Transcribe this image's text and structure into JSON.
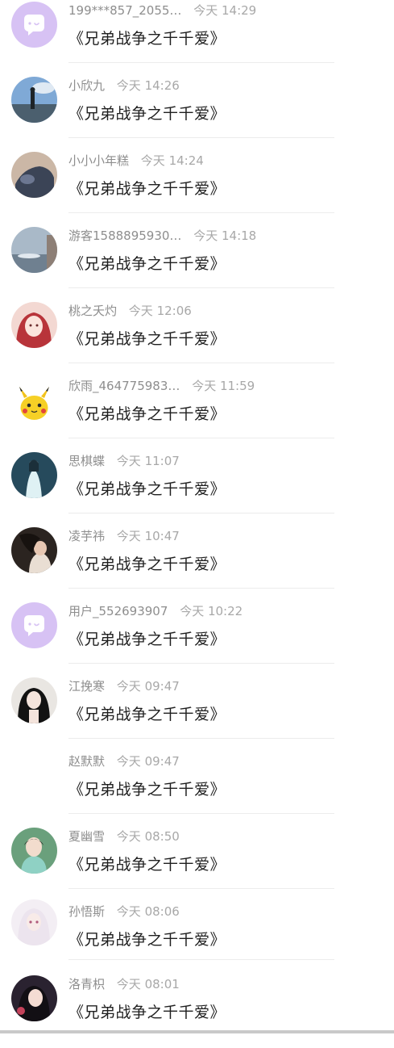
{
  "comments": [
    {
      "name": "199***857_2055…",
      "time": "今天 14:29",
      "title": "《兄弟战争之千千爱》",
      "avatar": "default-avatar"
    },
    {
      "name": "小欣九",
      "time": "今天 14:26",
      "title": "《兄弟战争之千千爱》",
      "avatar": "photo-avatar"
    },
    {
      "name": "小小小年糕",
      "time": "今天 14:24",
      "title": "《兄弟战争之千千爱》",
      "avatar": "photo-avatar"
    },
    {
      "name": "游客1588895930…",
      "time": "今天 14:18",
      "title": "《兄弟战争之千千爱》",
      "avatar": "photo-avatar"
    },
    {
      "name": "桃之夭灼",
      "time": "今天 12:06",
      "title": "《兄弟战争之千千爱》",
      "avatar": "photo-avatar"
    },
    {
      "name": "欣雨_464775983…",
      "time": "今天 11:59",
      "title": "《兄弟战争之千千爱》",
      "avatar": "pikachu-avatar"
    },
    {
      "name": "思棋蝶",
      "time": "今天 11:07",
      "title": "《兄弟战争之千千爱》",
      "avatar": "photo-avatar"
    },
    {
      "name": "凌芋祎",
      "time": "今天 10:47",
      "title": "《兄弟战争之千千爱》",
      "avatar": "photo-avatar"
    },
    {
      "name": "用户_552693907",
      "time": "今天 10:22",
      "title": "《兄弟战争之千千爱》",
      "avatar": "default-avatar"
    },
    {
      "name": "江挽寒",
      "time": "今天 09:47",
      "title": "《兄弟战争之千千爱》",
      "avatar": "photo-avatar"
    },
    {
      "name": "赵默默",
      "time": "今天 09:47",
      "title": "《兄弟战争之千千爱》",
      "avatar": "none"
    },
    {
      "name": "夏幽雪",
      "time": "今天 08:50",
      "title": "《兄弟战争之千千爱》",
      "avatar": "photo-avatar"
    },
    {
      "name": "孙悟斯",
      "time": "今天 08:06",
      "title": "《兄弟战争之千千爱》",
      "avatar": "photo-avatar"
    },
    {
      "name": "洛青枳",
      "time": "今天 08:01",
      "title": "《兄弟战争之千千爱》",
      "avatar": "photo-avatar"
    }
  ],
  "colors": {
    "default_avatar_bg": "#d7c2f4",
    "default_avatar_icon": "#ffffff",
    "name_text": "#8e8e8e",
    "time_text": "#a8a8a8",
    "title_text": "#1f1f1f",
    "divider": "#ececec"
  }
}
